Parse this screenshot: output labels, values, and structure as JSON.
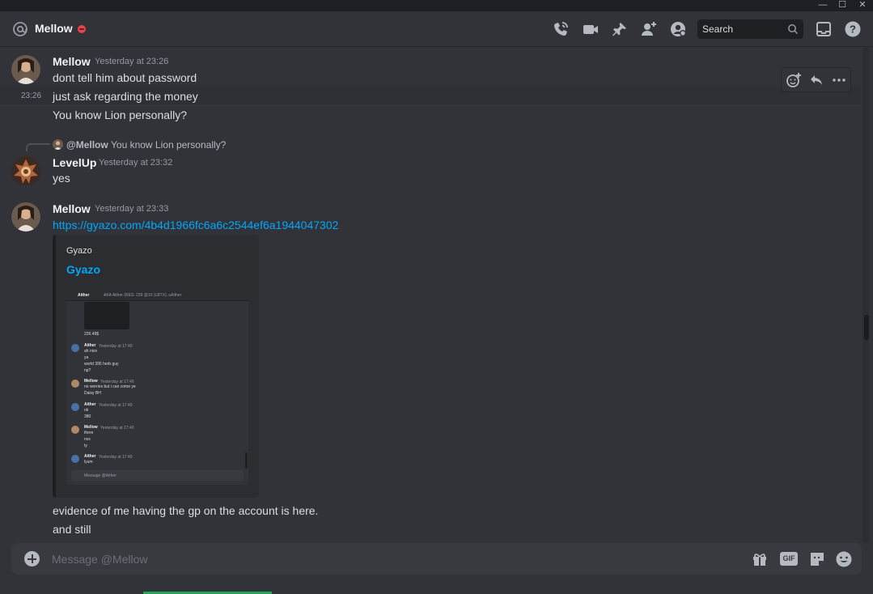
{
  "window": {
    "minimize": "—",
    "maximize": "☐",
    "close": "✕"
  },
  "header": {
    "channel_name": "Mellow",
    "search_placeholder": "Search",
    "icons": [
      "at-icon",
      "call-icon",
      "video-icon",
      "pin-icon",
      "add-friend-icon",
      "profile-icon",
      "inbox-icon",
      "help-icon"
    ],
    "status_color": "#f23f43"
  },
  "messages": [
    {
      "author": "Mellow",
      "timestamp": "Yesterday at 23:26",
      "lines": [
        "dont tell him about password",
        "just ask regarding the money",
        "You know Lion personally?"
      ],
      "hover_timestamp": "23:26"
    },
    {
      "reply_to": {
        "author": "@Mellow",
        "text": "You know Lion personally?"
      },
      "author": "LevelUp",
      "timestamp": "Yesterday at 23:32",
      "lines": [
        "yes"
      ]
    },
    {
      "author": "Mellow",
      "timestamp": "Yesterday at 23:33",
      "link": "https://gyazo.com/4b4d1966fc6a6c2544ef6a1944047302",
      "embed": {
        "provider": "Gyazo",
        "title": "Gyazo",
        "preview": {
          "header_name": "Aither",
          "header_meta": "AKA  Aither (RES: 239 @10 (LBTX), uAither",
          "amount": "226.49$",
          "messages": [
            {
              "author": "Aither",
              "time": "Yesterday at 17:40",
              "lines": [
                "ah nice",
                "ya",
                "world 395 herb guy",
                "np?"
              ]
            },
            {
              "author": "Mellow",
              "time": "Yesterday at 17:49",
              "lines": [
                "no worries but i can come ye",
                "Daisy BH"
              ]
            },
            {
              "author": "Aither",
              "time": "Yesterday at 17:40",
              "lines": [
                "ok",
                "380"
              ]
            },
            {
              "author": "Mellow",
              "time": "Yesterday at 17:40",
              "lines": [
                "there",
                "nvs",
                "ty"
              ]
            },
            {
              "author": "Aither",
              "time": "Yesterday at 17:40",
              "lines": [
                "lyum"
              ]
            }
          ],
          "input_placeholder": "Message @Aither"
        }
      },
      "lines": [
        "evidence of me having the gp on the account is here.",
        "and still"
      ]
    }
  ],
  "hover_toolbar": [
    "add-reaction-icon",
    "reply-icon",
    "more-icon"
  ],
  "composer": {
    "placeholder": "Message @Mellow",
    "gif_label": "GIF"
  },
  "colors": {
    "link": "#00a8fc",
    "background": "#313338",
    "accent_green": "#23a55a"
  }
}
